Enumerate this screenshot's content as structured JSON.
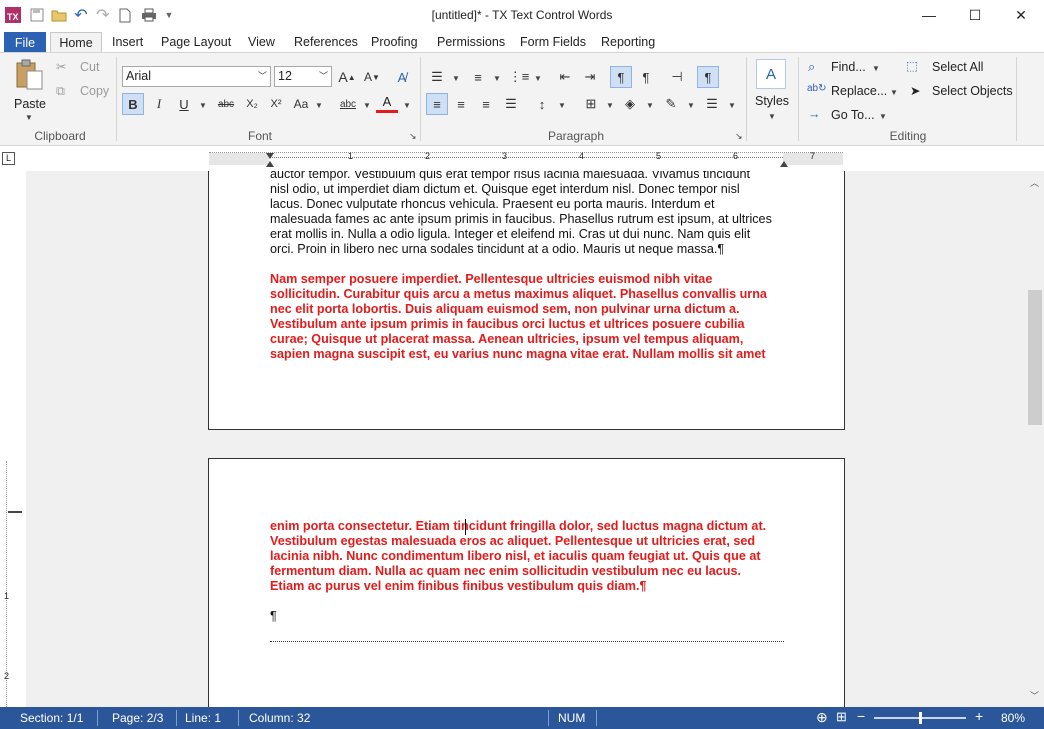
{
  "window": {
    "title": "[untitled]* - TX Text Control Words",
    "minimize_glyph": "—",
    "maximize_glyph": "☐",
    "close_glyph": "✕"
  },
  "quick_access": {
    "icons": [
      "app-logo-icon",
      "save-icon",
      "open-folder-icon",
      "undo-icon",
      "redo-icon",
      "new-document-icon",
      "print-icon",
      "customize-qat-icon"
    ]
  },
  "tabs": [
    "File",
    "Home",
    "Insert",
    "Page Layout",
    "View",
    "References",
    "Proofing",
    "Permissions",
    "Form Fields",
    "Reporting"
  ],
  "clipboard": {
    "paste_label": "Paste",
    "cut_label": "Cut",
    "copy_label": "Copy",
    "group_label": "Clipboard"
  },
  "font": {
    "family_value": "Arial",
    "size_value": "12",
    "group_label": "Font",
    "bold": "B",
    "italic": "I",
    "underline": "U",
    "strike": "abc",
    "subscript": "X₂",
    "superscript": "X²",
    "change_case": "Aa",
    "grow": "A",
    "shrink": "A",
    "highlight": "abc",
    "font_color": "A"
  },
  "paragraph": {
    "group_label": "Paragraph",
    "pilcrow": "¶"
  },
  "styles": {
    "label": "Styles",
    "icon_text": "A"
  },
  "editing": {
    "find_label": "Find...",
    "replace_label": "Replace...",
    "goto_label": "Go To...",
    "select_all_label": "Select All",
    "select_objects_label": "Select Objects",
    "group_label": "Editing"
  },
  "ruler": {
    "h_numbers": [
      "1",
      "2",
      "3",
      "4",
      "5",
      "6",
      "7"
    ],
    "v_numbers": [
      "1",
      "2"
    ]
  },
  "document": {
    "page1_black": [
      "auctor tempor. Vestibulum quis erat tempor risus lacinia malesuada. Vivamus tincidunt",
      "nisl odio, ut imperdiet diam dictum et. Quisque eget interdum nisl. Donec tempor nisl",
      "lacus. Donec vulputate rhoncus vehicula. Praesent eu porta mauris. Interdum et",
      "malesuada fames ac ante ipsum primis in faucibus. Phasellus rutrum est ipsum, at ultrices",
      "erat mollis in. Nulla a odio ligula. Integer et eleifend mi. Cras ut dui nunc. Nam quis elit",
      "orci. Proin in libero nec urna sodales tincidunt at a odio. Mauris ut neque massa.¶"
    ],
    "page1_red": [
      "Nam semper posuere imperdiet. Pellentesque ultricies euismod nibh vitae",
      "sollicitudin. Curabitur quis arcu a metus maximus aliquet. Phasellus convallis urna",
      "nec elit porta lobortis. Duis aliquam euismod sem, non pulvinar urna dictum a.",
      "Vestibulum ante ipsum primis in faucibus orci luctus et ultrices posuere cubilia",
      "curae; Quisque ut placerat massa. Aenean ultricies, ipsum vel tempus aliquam,",
      "sapien magna suscipit est, eu varius nunc magna vitae erat. Nullam mollis sit amet"
    ],
    "page2_red": [
      "enim porta consectetur. Etiam tincidunt fringilla dolor, sed luctus magna dictum at.",
      "Vestibulum egestas malesuada eros ac aliquet. Pellentesque ut ultricies erat, sed",
      "lacinia nibh. Nunc condimentum libero nisl, et iaculis quam feugiat ut. Quis que at",
      "fermentum diam. Nulla ac quam nec enim sollicitudin vestibulum nec eu lacus.",
      "Etiam ac purus vel enim finibus finibus vestibulum quis diam.¶"
    ],
    "page2_empty_para": "¶"
  },
  "status": {
    "section": "Section: 1/1",
    "page": "Page: 2/3",
    "line": "Line: 1",
    "column": "Column: 32",
    "num": "NUM",
    "zoom": "80%",
    "zoom_fraction": 0.5
  },
  "colors": {
    "accent": "#2b579a",
    "file_tab": "#2b62b3",
    "red_text": "#e21b1b"
  }
}
